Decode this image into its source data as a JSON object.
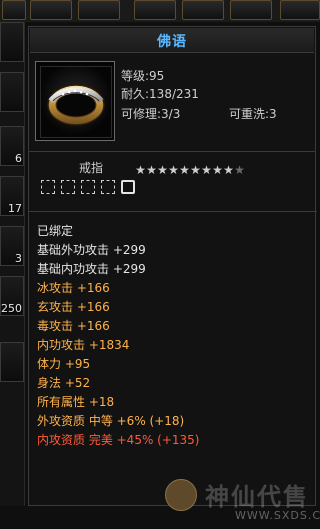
{
  "left_bar": {
    "slots": [
      {
        "count": ""
      },
      {
        "count": ""
      },
      {
        "count": "6"
      },
      {
        "count": "17"
      },
      {
        "count": "3"
      },
      {
        "count": "250"
      },
      {
        "count": ""
      }
    ]
  },
  "item": {
    "title": "佛语",
    "level": "等级:95",
    "durability": "耐久:138/231",
    "repairable": "可修理:3/3",
    "rewashable": "可重洗:3",
    "type_name": "戒指",
    "stars_total": 10,
    "stars_filled": 9,
    "sockets": [
      "",
      "",
      "",
      "",
      ""
    ],
    "bound": "已绑定",
    "attributes": [
      {
        "text": "基础外功攻击 +299",
        "color": "white"
      },
      {
        "text": "基础内功攻击 +299",
        "color": "white"
      },
      {
        "text": "冰攻击 +166",
        "color": "orange"
      },
      {
        "text": "玄攻击 +166",
        "color": "orange"
      },
      {
        "text": "毒攻击 +166",
        "color": "orange"
      },
      {
        "text": "内功攻击 +1834",
        "color": "orange"
      },
      {
        "text": "体力 +95",
        "color": "orange"
      },
      {
        "text": "身法 +52",
        "color": "orange"
      },
      {
        "text": "所有属性 +18",
        "color": "orange"
      },
      {
        "text": "外攻资质 中等 +6% (+18)",
        "color": "orange"
      },
      {
        "text": "内攻资质 完美 +45% (+135)",
        "color": "red"
      }
    ]
  },
  "watermark": {
    "chars": "神仙代售",
    "url": "WWW.SXDS.COM"
  },
  "colors": {
    "title": "#5bb7ff",
    "orange": "#ffb24b",
    "white": "#e6e6e6",
    "red": "#ff5a3a",
    "star_filled": "#cfcfcf",
    "star_empty": "#6a6a6a"
  }
}
